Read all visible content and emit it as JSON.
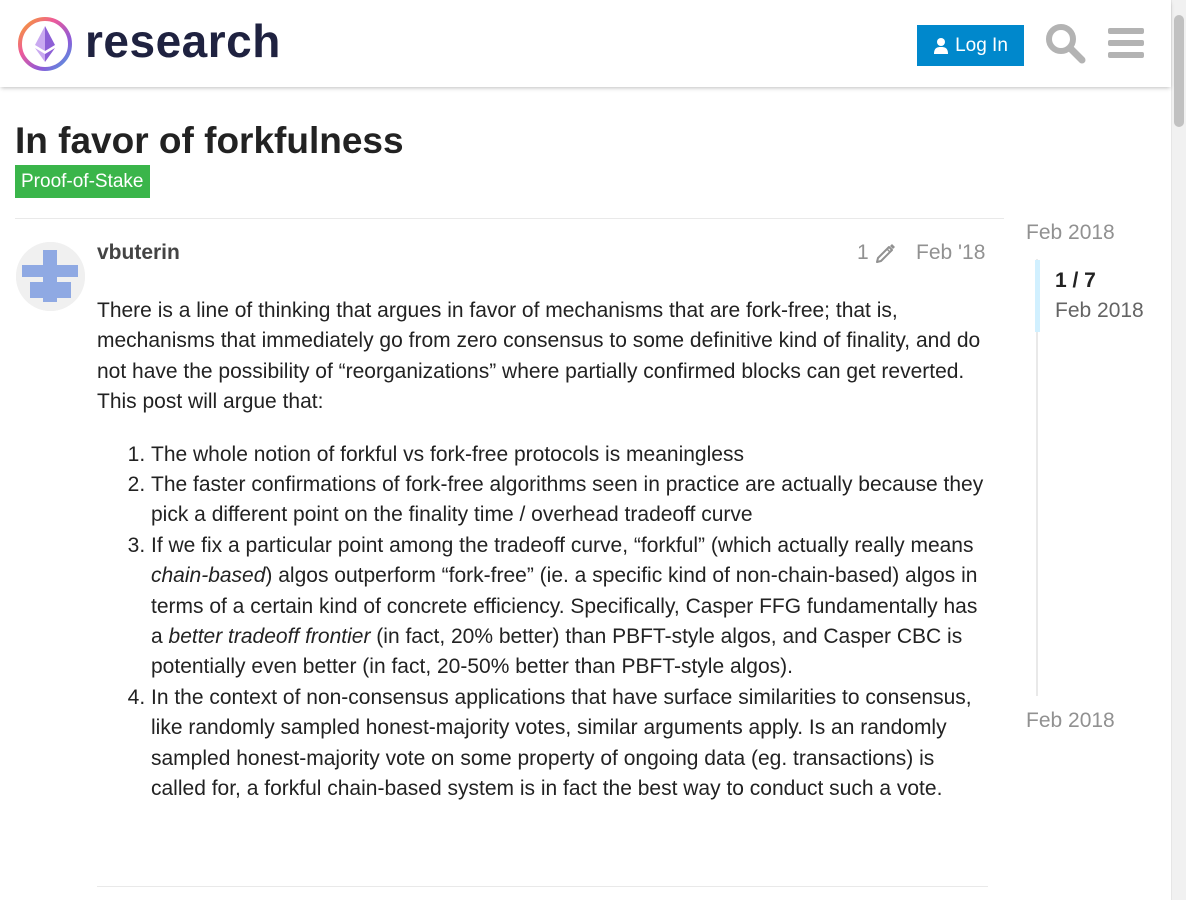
{
  "header": {
    "site_name": "research",
    "login_label": "Log In",
    "icons": [
      "logo-icon",
      "user-icon",
      "search-icon",
      "menu-icon"
    ]
  },
  "topic": {
    "title": "In favor of forkfulness",
    "category": "Proof-of-Stake",
    "category_color": "#3ab54a"
  },
  "post": {
    "username": "vbuterin",
    "edit_count": "1",
    "date": "Feb '18",
    "intro": "There is a line of thinking that argues in favor of mechanisms that are fork-free; that is, mechanisms that immediately go from zero consensus to some definitive kind of finality, and do not have the possibility of “reorganizations” where partially confirmed blocks can get reverted. This post will argue that:",
    "points": [
      {
        "text": "The whole notion of forkful vs fork-free protocols is meaningless"
      },
      {
        "text": "The faster confirmations of fork-free algorithms seen in practice are actually because they pick a different point on the finality time / overhead tradeoff curve"
      },
      {
        "part1": "If we fix a particular point among the tradeoff curve, “forkful” (which actually really means ",
        "em1": "chain-based",
        "part2": ") algos outperform “fork-free” (ie. a specific kind of non-chain-based) algos in terms of a certain kind of concrete efficiency. Specifically, Casper FFG fundamentally has a ",
        "em2": "better tradeoff frontier",
        "part3": " (in fact, 20% better) than PBFT-style algos, and Casper CBC is potentially even better (in fact, 20-50% better than PBFT-style algos)."
      },
      {
        "text": "In the context of non-consensus applications that have surface similarities to consensus, like randomly sampled honest-majority votes, similar arguments apply. Is an randomly sampled honest-majority vote on some property of ongoing data (eg. transactions) is called for, a forkful chain-based system is in fact the best way to conduct such a vote."
      }
    ]
  },
  "timeline": {
    "start_date": "Feb 2018",
    "position": "1 / 7",
    "current_date": "Feb 2018",
    "end_date": "Feb 2018"
  },
  "colors": {
    "accent": "#0088cc",
    "timeline_handle": "#d1f0ff"
  }
}
